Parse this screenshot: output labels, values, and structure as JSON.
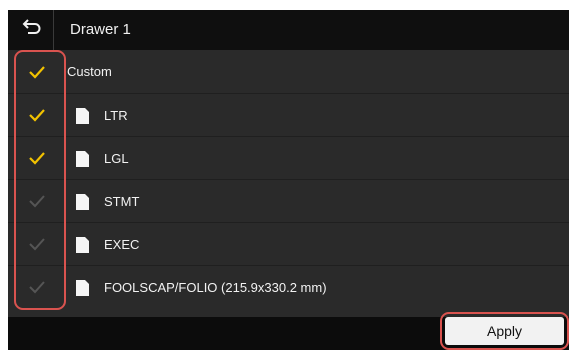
{
  "header": {
    "title": "Drawer 1",
    "back_icon": "back-arrow-icon"
  },
  "items": [
    {
      "label": "Custom",
      "checked": true,
      "icon": ""
    },
    {
      "label": "LTR",
      "checked": true,
      "icon": "paper-icon"
    },
    {
      "label": "LGL",
      "checked": true,
      "icon": "paper-icon"
    },
    {
      "label": "STMT",
      "checked": false,
      "icon": "paper-icon"
    },
    {
      "label": "EXEC",
      "checked": false,
      "icon": "paper-icon"
    },
    {
      "label": "FOOLSCAP/FOLIO (215.9x330.2 mm)",
      "checked": false,
      "icon": "paper-icon"
    }
  ],
  "footer": {
    "apply_label": "Apply"
  },
  "colors": {
    "check_on": "#f2c200",
    "check_off": "#555555",
    "highlight": "#d9534f"
  }
}
